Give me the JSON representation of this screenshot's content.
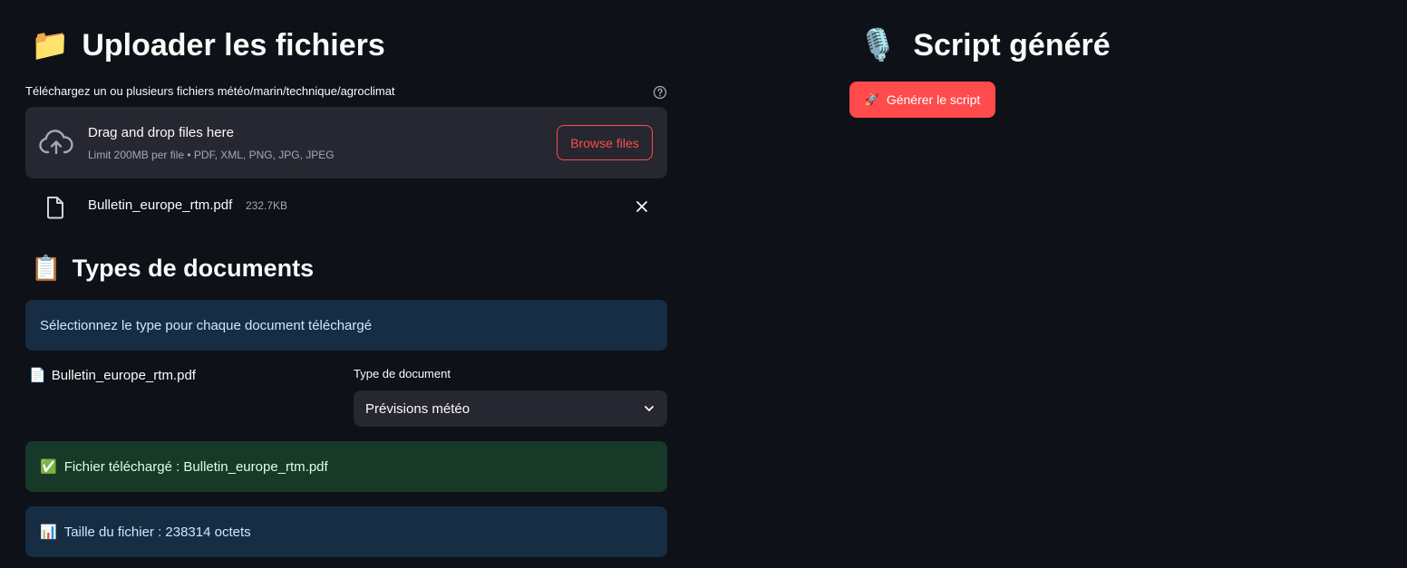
{
  "left": {
    "upload_heading": {
      "emoji": "📁",
      "text": "Uploader les fichiers"
    },
    "uploader": {
      "label": "Téléchargez un ou plusieurs fichiers météo/marin/technique/agroclimat",
      "drop_title": "Drag and drop files here",
      "drop_subtitle": "Limit 200MB per file • PDF, XML, PNG, JPG, JPEG",
      "browse_label": "Browse files",
      "help_icon": "help-circle-icon",
      "cloud_icon": "cloud-upload-icon"
    },
    "uploaded_file": {
      "name": "Bulletin_europe_rtm.pdf",
      "size": "232.7KB",
      "icon": "file-icon"
    },
    "types_heading": {
      "emoji": "📋",
      "text": "Types de documents"
    },
    "info_message": "Sélectionnez le type pour chaque document téléchargé",
    "document_row": {
      "emoji": "📄",
      "name": "Bulletin_europe_rtm.pdf",
      "select_label": "Type de document",
      "select_value": "Prévisions météo"
    },
    "success_message": {
      "emoji": "✅",
      "text": "Fichier téléchargé : Bulletin_europe_rtm.pdf"
    },
    "size_message": {
      "emoji": "📊",
      "text": "Taille du fichier : 238314 octets"
    }
  },
  "right": {
    "script_heading": {
      "emoji": "🎙️",
      "text": "Script généré"
    },
    "generate_button": {
      "emoji": "🚀",
      "label": "Générer le script"
    }
  },
  "colors": {
    "background": "#0e1117",
    "accent": "#ff4b4b",
    "widget_bg": "#262730",
    "info_bg": "#172d43",
    "success_bg": "#173928"
  }
}
